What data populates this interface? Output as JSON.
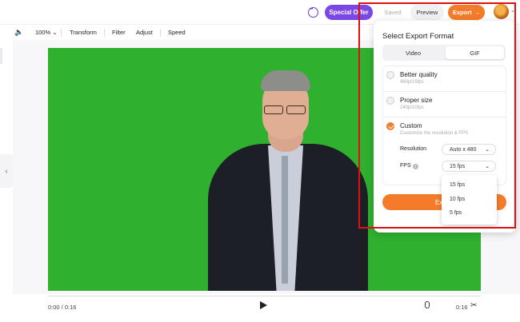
{
  "topbar": {
    "chat_icon": "chat-bubble-icon",
    "special_offer_label": "Special Offer",
    "saved_label": "Saved",
    "preview_label": "Preview",
    "export_label": "Export",
    "export_arrow": "→",
    "avatar_icon": "user-avatar",
    "accent_color": "#7b46e6",
    "export_color": "#f47b2a"
  },
  "toolbar": {
    "volume_icon": "🔈",
    "zoom": "100%",
    "zoom_chevron": "⌄",
    "items": [
      "Transform",
      "Filter",
      "Adjust",
      "Speed"
    ]
  },
  "side": {
    "collapse_icon": "‹"
  },
  "player": {
    "current_time": "0:00 / 0:16",
    "duration": "0:16",
    "scissors": "✂"
  },
  "export_panel": {
    "title": "Select Export Format",
    "tabs": [
      "Video",
      "GIF"
    ],
    "selected_tab": "GIF",
    "options": [
      {
        "title": "Better quality",
        "subtitle": "480p/15fps",
        "checked": false
      },
      {
        "title": "Proper size",
        "subtitle": "240p/10fps",
        "checked": false
      },
      {
        "title": "Custom",
        "subtitle": "Customize the resolution & FPS",
        "checked": true
      }
    ],
    "resolution_label": "Resolution",
    "resolution_value": "Auto x 480",
    "fps_label": "FPS",
    "fps_value": "15 fps",
    "chevron": "⌄",
    "info_glyph": "i",
    "export_button": "Export"
  },
  "fps_dropdown": {
    "options": [
      "15 fps",
      "10 fps",
      "5 fps"
    ]
  }
}
